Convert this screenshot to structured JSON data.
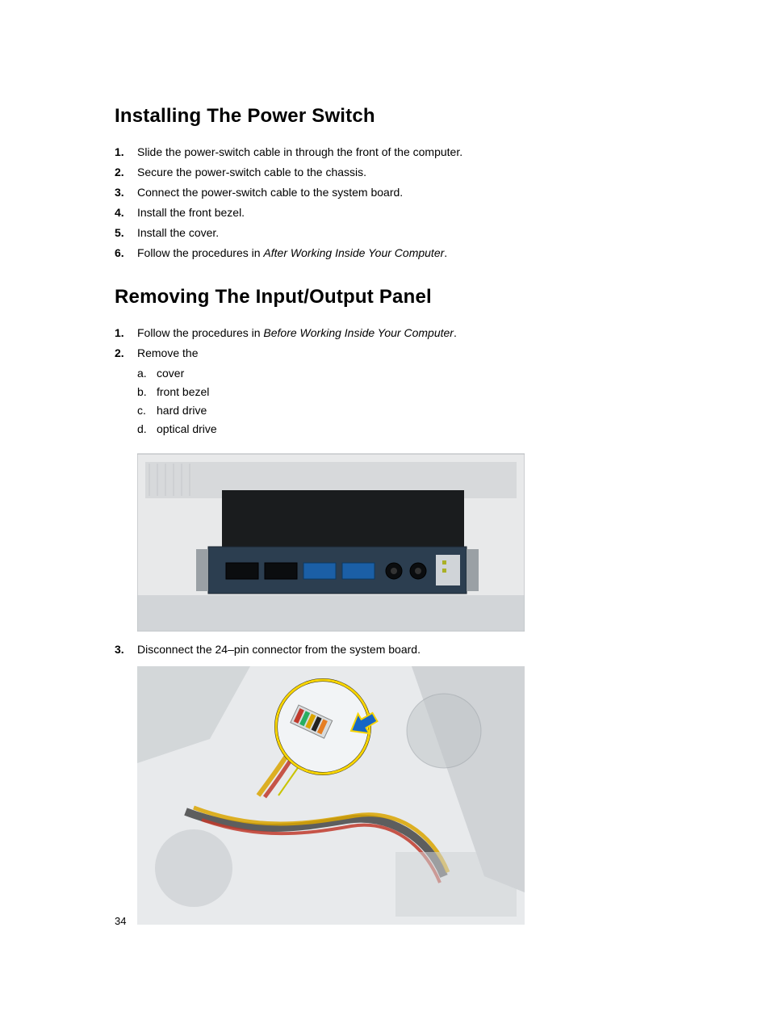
{
  "section1": {
    "heading": "Installing The Power Switch",
    "steps": [
      {
        "num": "1.",
        "text": "Slide the power-switch cable in through the front of the computer."
      },
      {
        "num": "2.",
        "text": "Secure the power-switch cable to the chassis."
      },
      {
        "num": "3.",
        "text": "Connect the power-switch cable to the system board."
      },
      {
        "num": "4.",
        "text": "Install the front bezel."
      },
      {
        "num": "5.",
        "text": "Install the cover."
      },
      {
        "num": "6.",
        "pre": "Follow the procedures in ",
        "italic": "After Working Inside Your Computer",
        "post": "."
      }
    ]
  },
  "section2": {
    "heading": "Removing The Input/Output Panel",
    "steps": [
      {
        "num": "1.",
        "pre": "Follow the procedures in ",
        "italic": "Before Working Inside Your Computer",
        "post": "."
      },
      {
        "num": "2.",
        "text": "Remove the",
        "sub": [
          {
            "letter": "a.",
            "text": "cover"
          },
          {
            "letter": "b.",
            "text": "front bezel"
          },
          {
            "letter": "c.",
            "text": "hard drive"
          },
          {
            "letter": "d.",
            "text": "optical drive"
          }
        ]
      },
      {
        "num": "3.",
        "text": "Disconnect the 24–pin connector from the system board."
      }
    ]
  },
  "page_number": "34"
}
